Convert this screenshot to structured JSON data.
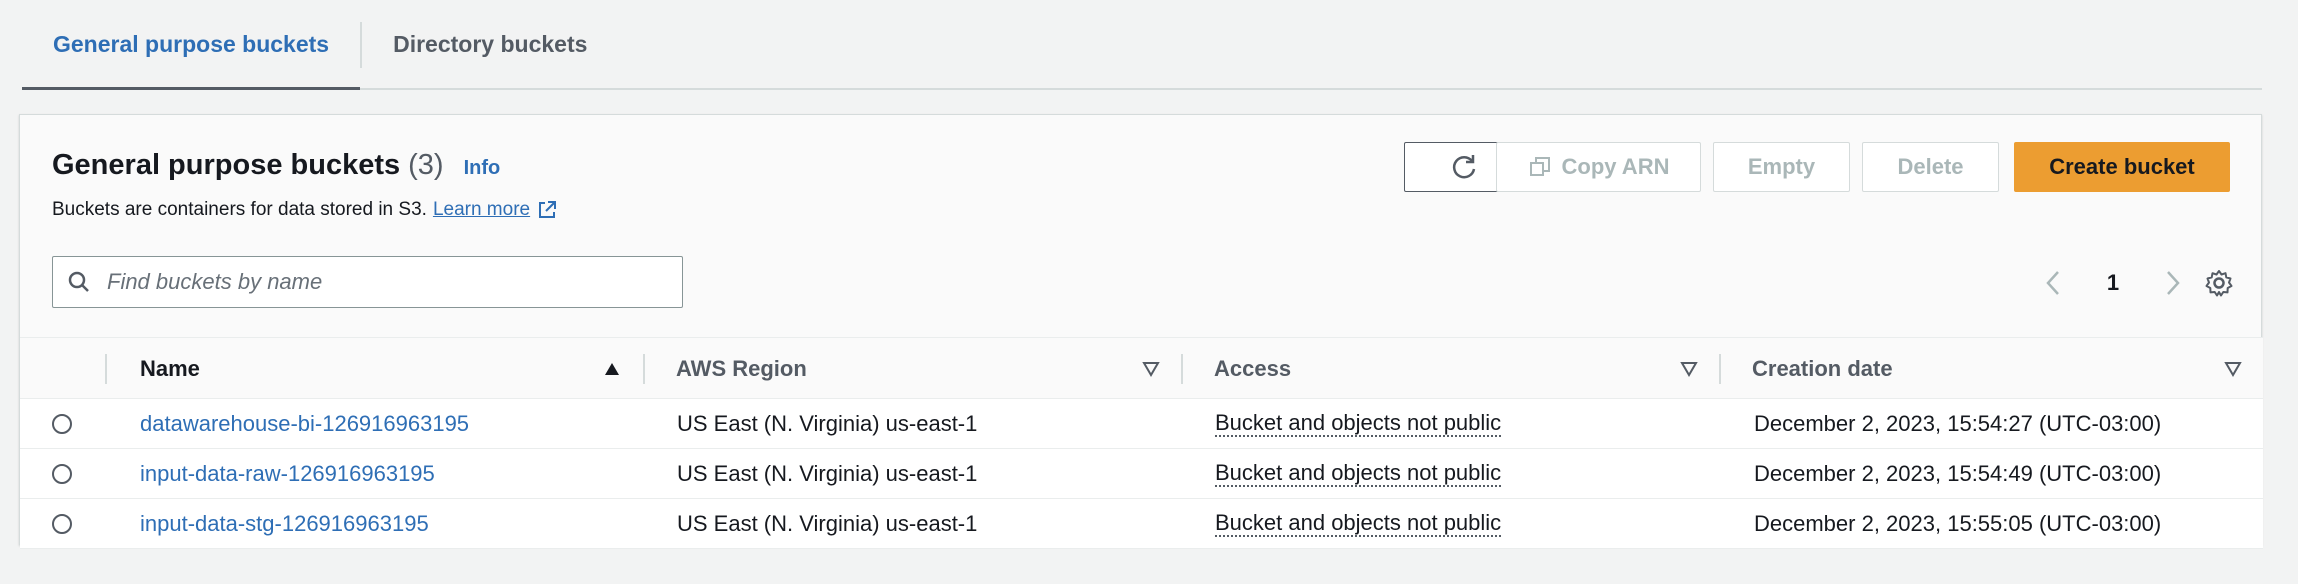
{
  "tabs": [
    {
      "label": "General purpose buckets",
      "active": true
    },
    {
      "label": "Directory buckets",
      "active": false
    }
  ],
  "panel": {
    "title": "General purpose buckets",
    "count": "(3)",
    "info_label": "Info",
    "description": "Buckets are containers for data stored in S3.",
    "learn_more": "Learn more"
  },
  "actions": {
    "copy_arn": "Copy ARN",
    "empty": "Empty",
    "delete": "Delete",
    "create_bucket": "Create bucket"
  },
  "search": {
    "placeholder": "Find buckets by name",
    "value": ""
  },
  "pagination": {
    "current_page": "1"
  },
  "table": {
    "columns": {
      "name": "Name",
      "region": "AWS Region",
      "access": "Access",
      "creation_date": "Creation date"
    },
    "rows": [
      {
        "name": "datawarehouse-bi-126916963195",
        "region": "US East (N. Virginia) us-east-1",
        "access": "Bucket and objects not public",
        "creation_date": "December 2, 2023, 15:54:27 (UTC-03:00)"
      },
      {
        "name": "input-data-raw-126916963195",
        "region": "US East (N. Virginia) us-east-1",
        "access": "Bucket and objects not public",
        "creation_date": "December 2, 2023, 15:54:49 (UTC-03:00)"
      },
      {
        "name": "input-data-stg-126916963195",
        "region": "US East (N. Virginia) us-east-1",
        "access": "Bucket and objects not public",
        "creation_date": "December 2, 2023, 15:55:05 (UTC-03:00)"
      }
    ]
  },
  "colors": {
    "accent_link": "#2e6eb5",
    "primary_button": "#ec9d31",
    "background": "#f2f3f3"
  }
}
